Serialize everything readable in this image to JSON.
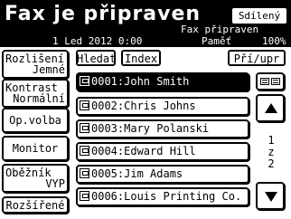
{
  "header": {
    "title": "Fax je připraven",
    "shared_label": "Sdílený",
    "status_text": "Fax připraven",
    "datetime": "1 Led 2012  0:00",
    "memory_label": "Paměť",
    "memory_value": "100%"
  },
  "left_buttons": {
    "resolution": {
      "label": "Rozlišení",
      "value": "Jemné"
    },
    "contrast": {
      "label": "Kontrast",
      "value": "Normální"
    },
    "opvolba": {
      "label": "Op.volba"
    },
    "monitor": {
      "label": "Monitor"
    },
    "obeznik": {
      "label": "Oběžník",
      "value": "VYP"
    },
    "extended": {
      "label": "Rozšířené"
    }
  },
  "tabs": {
    "search": "Hledat",
    "index": "Index",
    "receive": "Pří/upr"
  },
  "entries": [
    {
      "text": "0001:John Smith",
      "selected": true
    },
    {
      "text": "0002:Chris Johns",
      "selected": false
    },
    {
      "text": "0003:Mary Polanski",
      "selected": false
    },
    {
      "text": "0004:Edward Hill",
      "selected": false
    },
    {
      "text": "0005:Jim Adams",
      "selected": false
    },
    {
      "text": "0006:Louis Printing Co.",
      "selected": false
    }
  ],
  "pager": {
    "current": "1",
    "separator": "z",
    "total": "2"
  },
  "icons": {
    "list_view": "list-view-icon",
    "up": "arrow-up-icon",
    "down": "arrow-down-icon",
    "entry": "fax-contact-icon"
  }
}
